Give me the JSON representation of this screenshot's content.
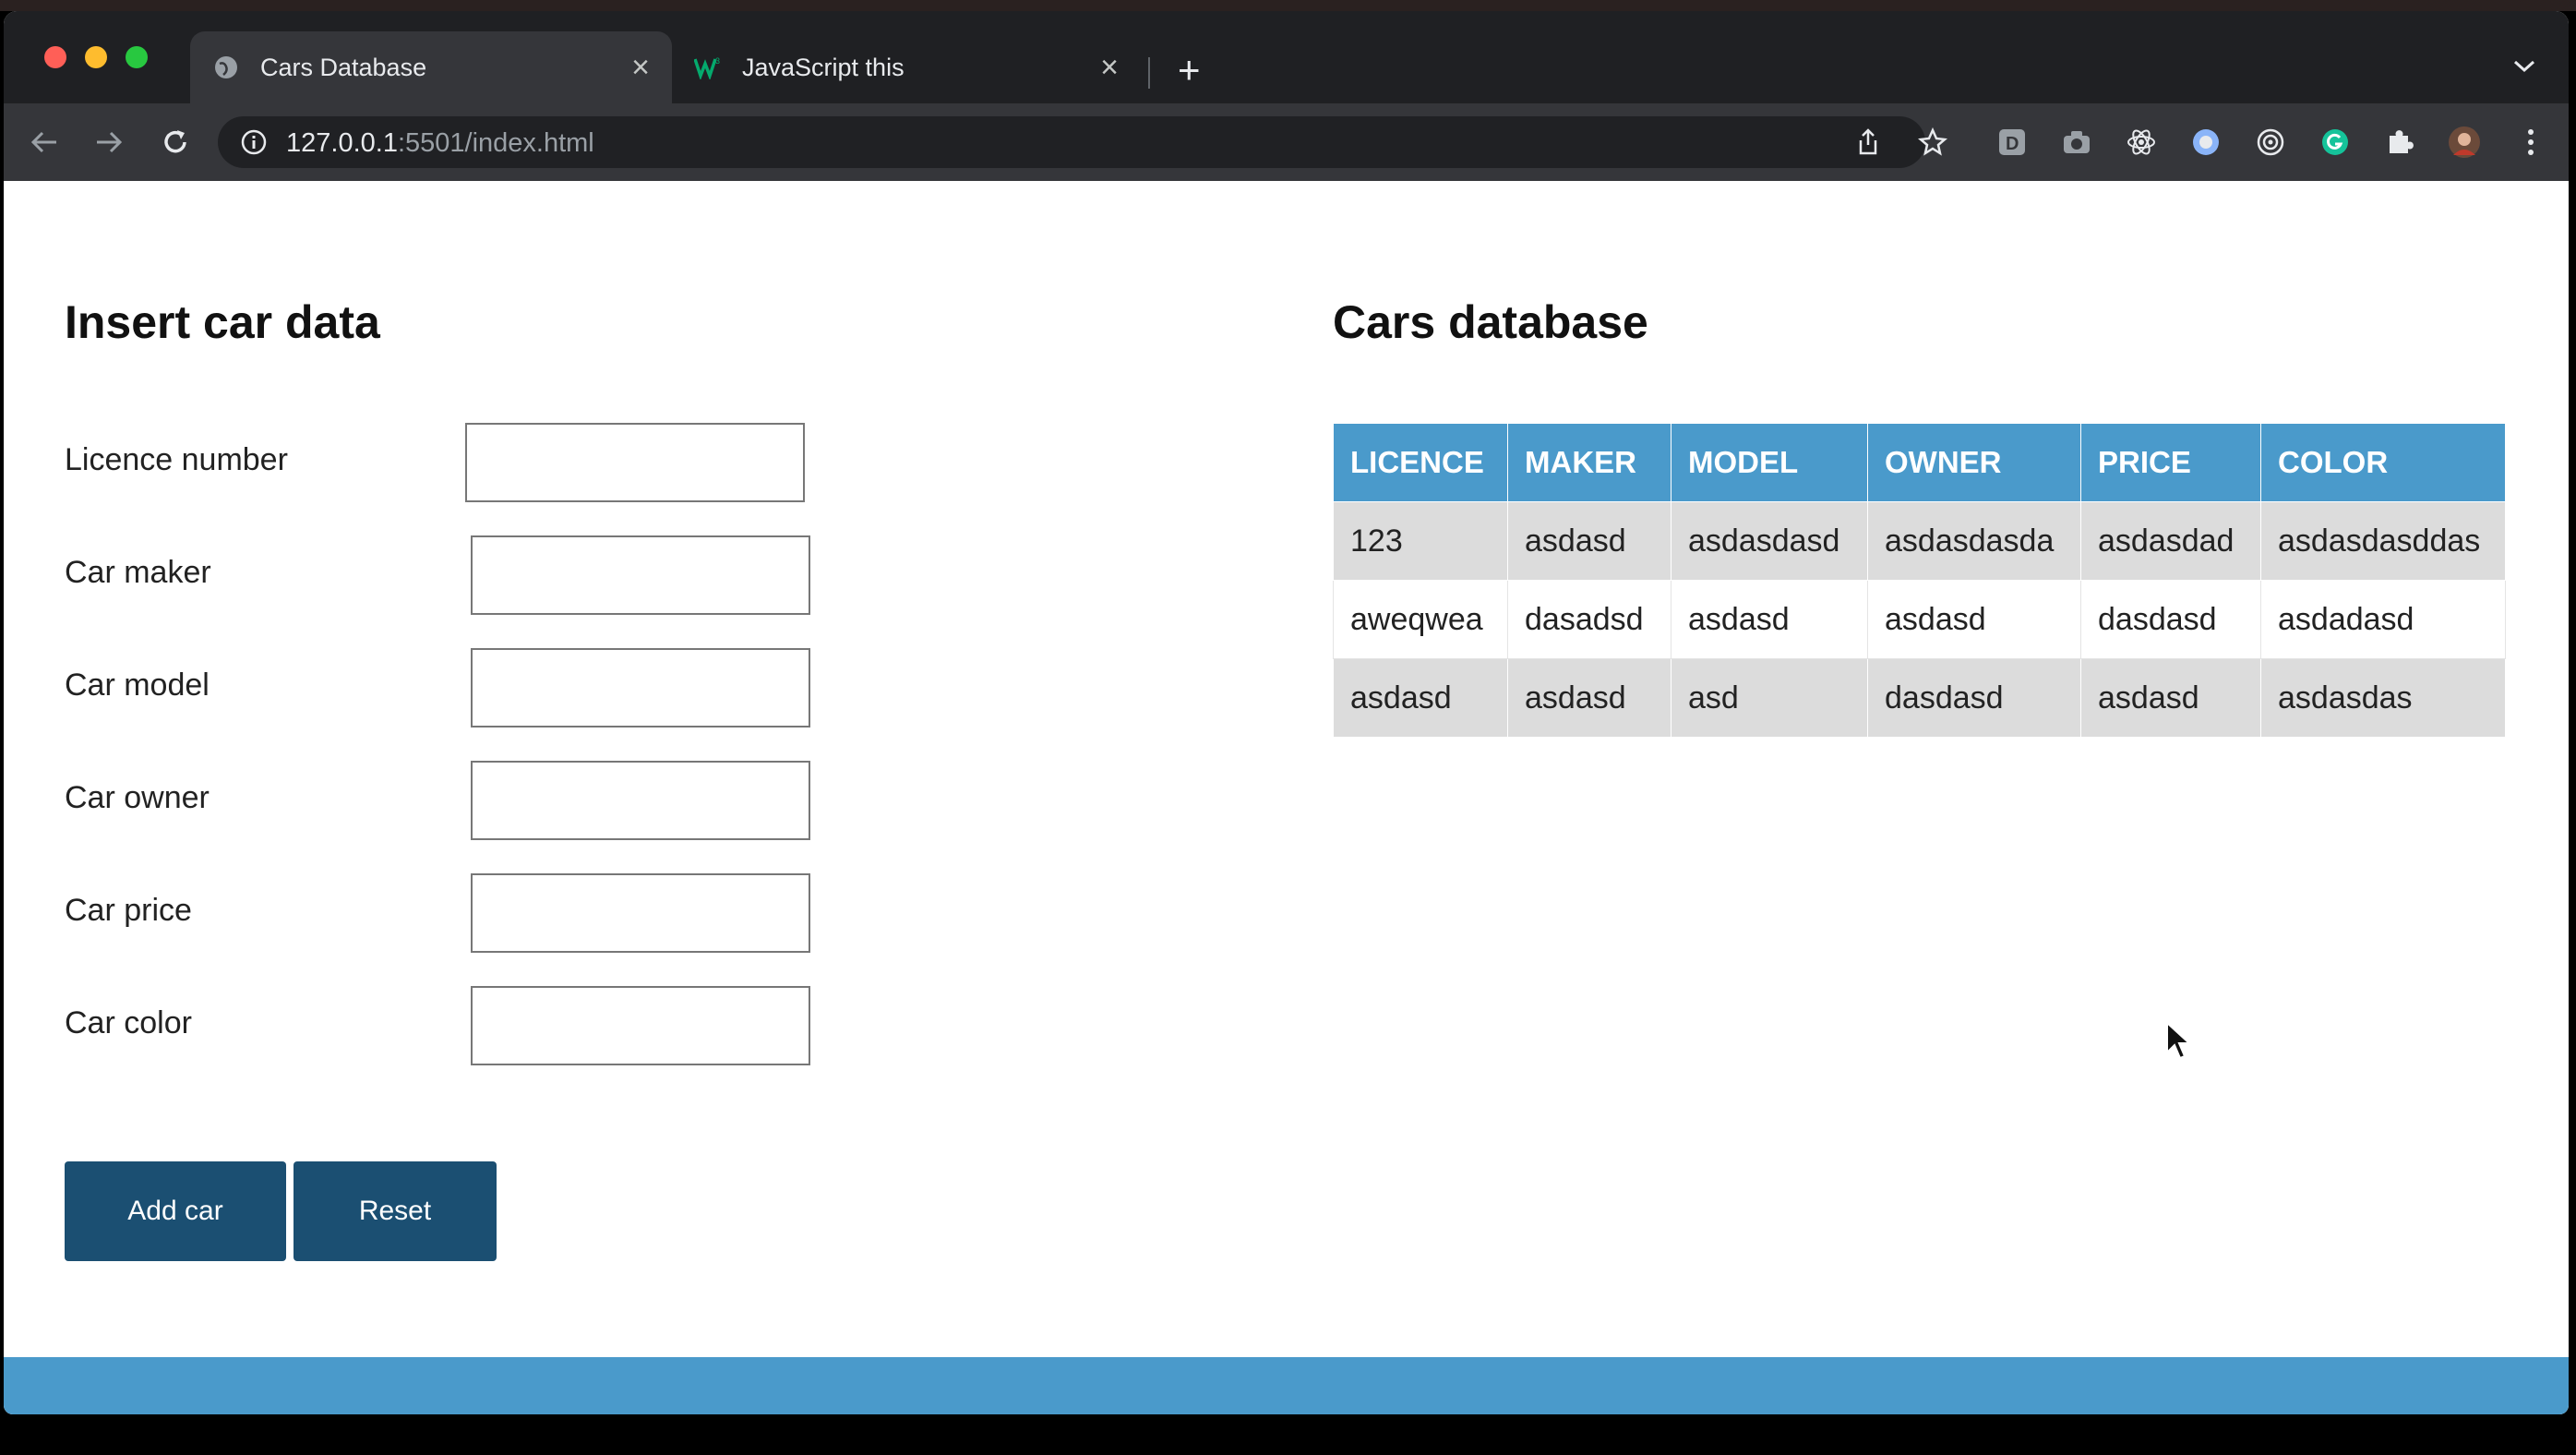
{
  "browser": {
    "tabs": [
      {
        "title": "Cars Database",
        "active": true
      },
      {
        "title": "JavaScript this",
        "active": false
      }
    ],
    "address": {
      "host": "127.0.0.1",
      "rest": ":5501/index.html"
    }
  },
  "form": {
    "heading": "Insert car data",
    "fields": [
      {
        "label": "Licence number",
        "value": ""
      },
      {
        "label": "Car maker",
        "value": ""
      },
      {
        "label": "Car model",
        "value": ""
      },
      {
        "label": "Car owner",
        "value": ""
      },
      {
        "label": "Car price",
        "value": ""
      },
      {
        "label": "Car color",
        "value": ""
      }
    ],
    "add_label": "Add car",
    "reset_label": "Reset"
  },
  "database": {
    "heading": "Cars database",
    "columns": [
      "LICENCE",
      "MAKER",
      "MODEL",
      "OWNER",
      "PRICE",
      "COLOR"
    ],
    "rows": [
      [
        "123",
        "asdasd",
        "asdasdasd",
        "asdasdasda",
        "asdasdad",
        "asdasdasddas"
      ],
      [
        "aweqwea",
        "dasadsd",
        "asdasd",
        "asdasd",
        "dasdasd",
        "asdadasd"
      ],
      [
        "asdasd",
        "asdasd",
        "asd",
        "dasdasd",
        "asdasd",
        "asdasdas"
      ]
    ]
  },
  "colors": {
    "accent": "#4a9acb",
    "button": "#1b4f72"
  }
}
